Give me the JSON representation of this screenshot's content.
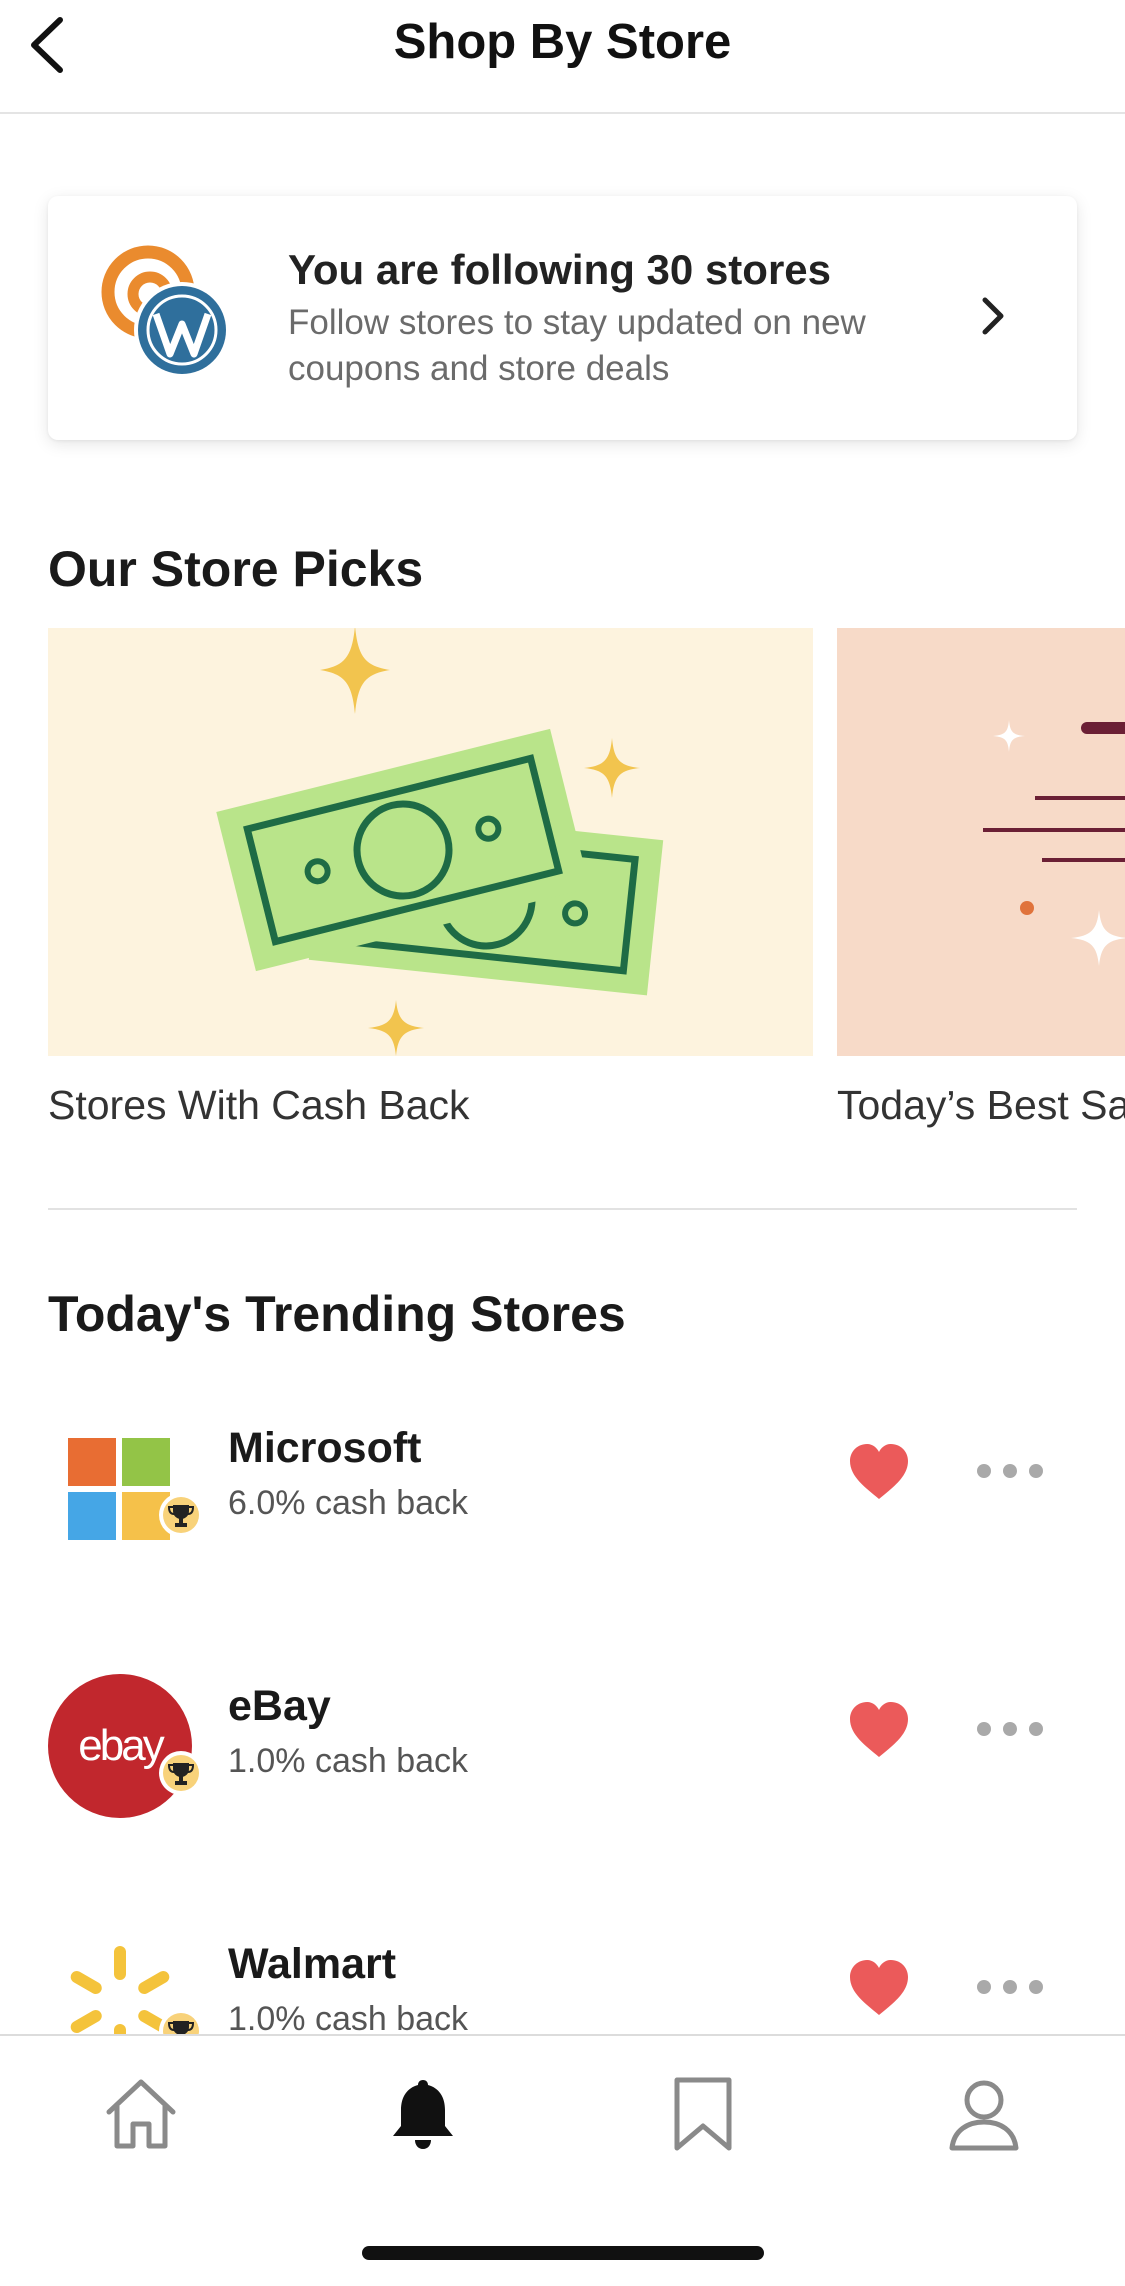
{
  "header": {
    "title": "Shop By Store"
  },
  "follow_card": {
    "title": "You are following 30 stores",
    "subtitle": "Follow stores to stay updated on new coupons and store deals"
  },
  "store_picks": {
    "title": "Our Store Picks",
    "items": [
      {
        "label": "Stores With Cash Back"
      },
      {
        "label": "Today’s Best Sales"
      }
    ]
  },
  "trending": {
    "title": "Today's Trending Stores",
    "stores": [
      {
        "name": "Microsoft",
        "cash_back": "6.0% cash back",
        "favorited": true
      },
      {
        "name": "eBay",
        "cash_back": "1.0% cash back",
        "favorited": true,
        "logo_text": "ebay"
      },
      {
        "name": "Walmart",
        "cash_back": "1.0% cash back",
        "favorited": true
      }
    ]
  },
  "bottom_nav": {
    "items": [
      {
        "icon": "home-icon",
        "active": false
      },
      {
        "icon": "bell-icon",
        "active": true
      },
      {
        "icon": "bookmark-icon",
        "active": false
      },
      {
        "icon": "profile-icon",
        "active": false
      }
    ]
  },
  "colors": {
    "heart": "#eb5a5a",
    "cashback_bg": "#fdf3de",
    "sales_bg": "#f7dac8",
    "money_green": "#b9e48a",
    "money_stroke": "#1e6b45",
    "sparkle": "#f2c44e",
    "ebay_red": "#c1272d"
  }
}
